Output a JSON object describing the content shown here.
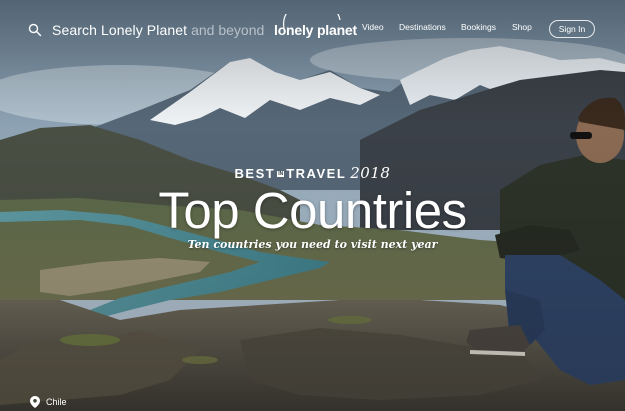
{
  "header": {
    "search": {
      "placeholder_main": "Search Lonely Planet",
      "placeholder_rest": "and beyond",
      "icon": "search-icon"
    },
    "logo_text": "lonely planet",
    "nav": {
      "video": "Video",
      "destinations": "Destinations",
      "bookings": "Bookings",
      "shop": "Shop"
    },
    "sign_in": "Sign In"
  },
  "hero": {
    "badge": {
      "best": "BEST",
      "in": "IN",
      "travel": "TRAVEL",
      "year": "2018"
    },
    "title": "Top Countries",
    "subtitle": "Ten countries you need to visit next year",
    "location": "Chile",
    "location_icon": "map-pin-icon"
  },
  "colors": {
    "sky": "#8fa6b9",
    "snow": "#f1f4f7",
    "text": "#ffffff"
  }
}
